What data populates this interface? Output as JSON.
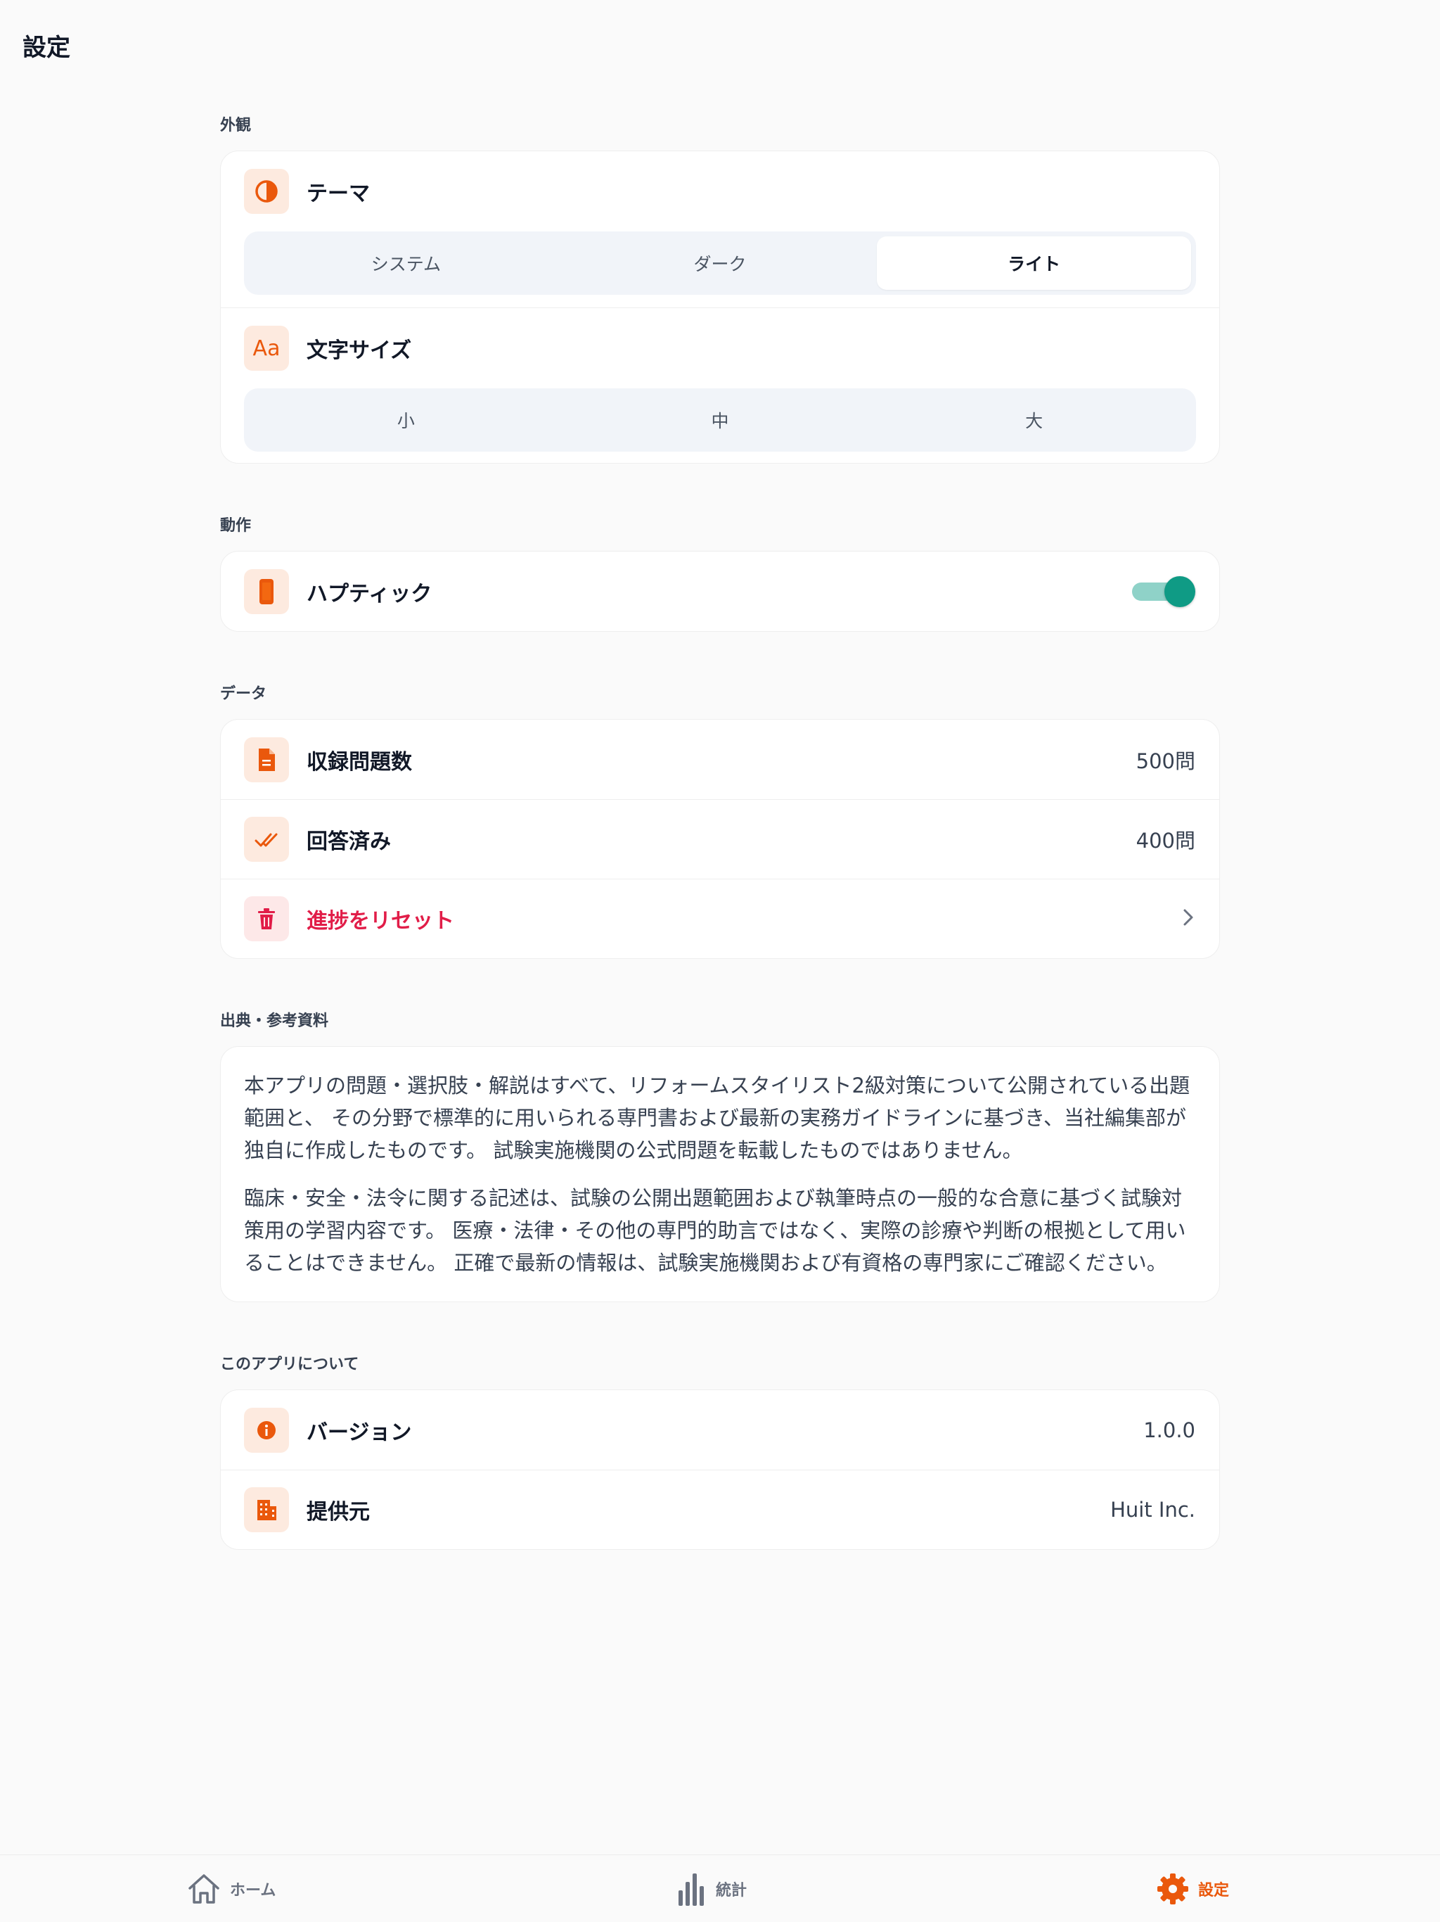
{
  "page": {
    "title": "設定"
  },
  "appearance": {
    "section_label": "外観",
    "theme": {
      "label": "テーマ",
      "options": [
        "システム",
        "ダーク",
        "ライト"
      ],
      "selected": "ライト"
    },
    "font_size": {
      "label": "文字サイズ",
      "options": [
        "小",
        "中",
        "大"
      ],
      "selected": ""
    }
  },
  "behavior": {
    "section_label": "動作",
    "haptics": {
      "label": "ハプティック",
      "enabled": true
    }
  },
  "data_section": {
    "section_label": "データ",
    "question_count": {
      "label": "収録問題数",
      "value": "500問"
    },
    "answered": {
      "label": "回答済み",
      "value": "400問"
    },
    "reset": {
      "label": "進捗をリセット"
    }
  },
  "sources": {
    "section_label": "出典・参考資料",
    "paragraph1": "本アプリの問題・選択肢・解説はすべて、リフォームスタイリスト2級対策について公開されている出題範囲と、 その分野で標準的に用いられる専門書および最新の実務ガイドラインに基づき、当社編集部が独自に作成したものです。 試験実施機関の公式問題を転載したものではありません。",
    "paragraph2": "臨床・安全・法令に関する記述は、試験の公開出題範囲および執筆時点の一般的な合意に基づく試験対策用の学習内容です。 医療・法律・その他の専門的助言ではなく、実際の診療や判断の根拠として用いることはできません。 正確で最新の情報は、試験実施機関および有資格の専門家にご確認ください。"
  },
  "about": {
    "section_label": "このアプリについて",
    "version": {
      "label": "バージョン",
      "value": "1.0.0"
    },
    "provider": {
      "label": "提供元",
      "value": "Huit Inc."
    }
  },
  "tabbar": {
    "home": "ホーム",
    "stats": "統計",
    "settings": "設定",
    "active": "settings"
  },
  "colors": {
    "accent": "#ea580c",
    "danger": "#e11d48",
    "toggle_on": "#0f9b85"
  }
}
